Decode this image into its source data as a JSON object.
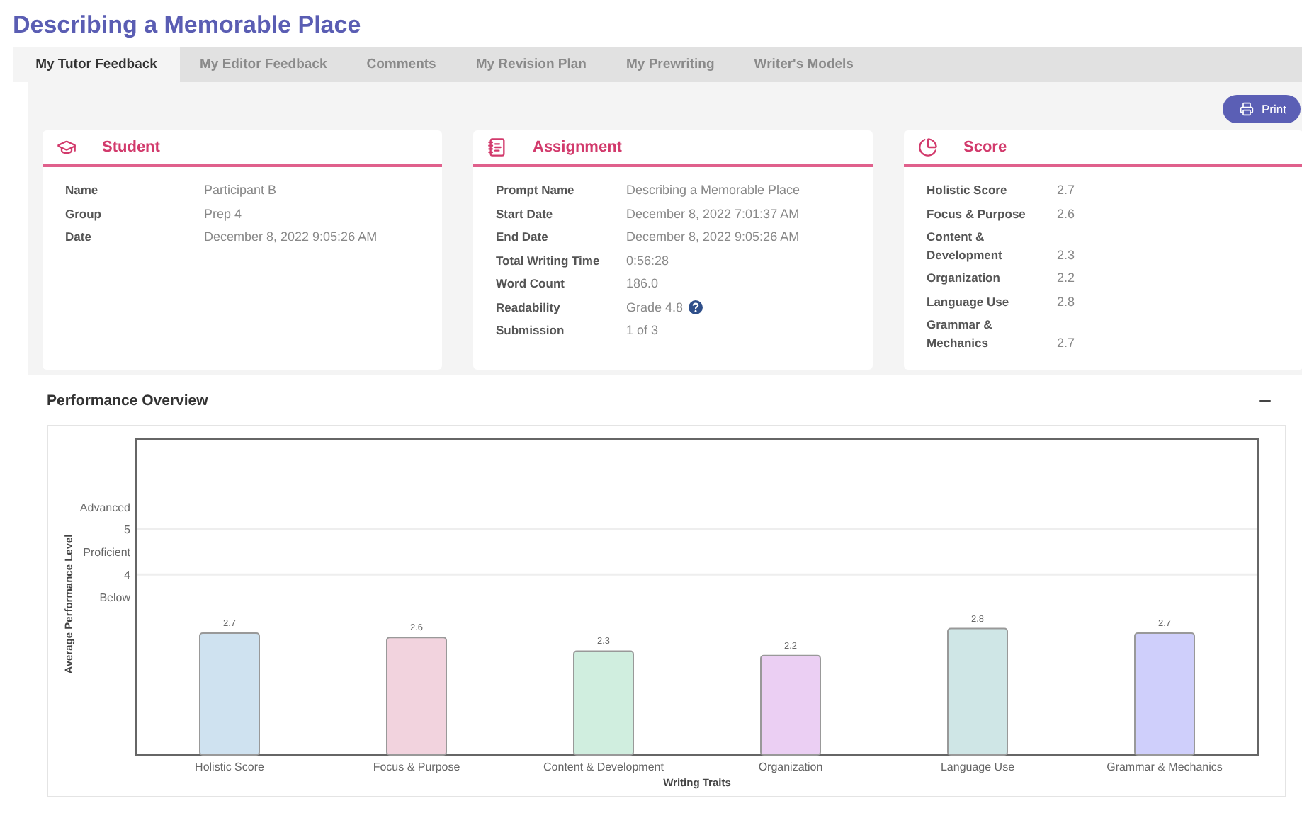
{
  "title": "Describing a Memorable Place",
  "tabs": [
    {
      "label": "My Tutor Feedback",
      "selected": true
    },
    {
      "label": "My Editor Feedback",
      "selected": false
    },
    {
      "label": "Comments",
      "selected": false
    },
    {
      "label": "My Revision Plan",
      "selected": false
    },
    {
      "label": "My Prewriting",
      "selected": false
    },
    {
      "label": "Writer's Models",
      "selected": false
    }
  ],
  "print_button": "Print",
  "cards": [
    {
      "kind": "student",
      "title": "Student",
      "rows": [
        {
          "label": "Name",
          "value": "Participant B",
          "help": false
        },
        {
          "label": "Group",
          "value": "Prep 4",
          "help": false
        },
        {
          "label": "Date",
          "value": "December 8, 2022 9:05:26 AM",
          "help": false
        }
      ]
    },
    {
      "kind": "assignment",
      "title": "Assignment",
      "rows": [
        {
          "label": "Prompt Name",
          "value": "Describing a Memorable Place",
          "help": false
        },
        {
          "label": "Start Date",
          "value": "December 8, 2022 7:01:37 AM",
          "help": false
        },
        {
          "label": "End Date",
          "value": "December 8, 2022 9:05:26 AM",
          "help": false
        },
        {
          "label": "Total Writing Time",
          "value": "0:56:28",
          "help": false
        },
        {
          "label": "Word Count",
          "value": "186.0",
          "help": false
        },
        {
          "label": "Readability",
          "value": "Grade 4.8",
          "help": true
        },
        {
          "label": "Submission",
          "value": "1 of 3",
          "help": false
        }
      ]
    },
    {
      "kind": "score",
      "title": "Score",
      "rows": [
        {
          "label": "Holistic Score",
          "value": "2.7",
          "help": false
        },
        {
          "label": "Focus & Purpose",
          "value": "2.6",
          "help": false
        },
        {
          "label": "Content & Development",
          "value": "2.3",
          "help": false
        },
        {
          "label": "Organization",
          "value": "2.2",
          "help": false
        },
        {
          "label": "Language Use",
          "value": "2.8",
          "help": false
        },
        {
          "label": "Grammar & Mechanics",
          "value": "2.7",
          "help": false
        }
      ]
    }
  ],
  "performance": {
    "title": "Performance Overview",
    "expanded": true,
    "chart_data": {
      "type": "bar",
      "xlabel": "Writing Traits",
      "ylabel": "Average Performance Level",
      "categories": [
        "Holistic Score",
        "Focus & Purpose",
        "Content & Development",
        "Organization",
        "Language Use",
        "Grammar & Mechanics"
      ],
      "values": [
        2.7,
        2.6,
        2.3,
        2.2,
        2.8,
        2.7
      ],
      "colors": [
        "#cfe2f0",
        "#f2d3de",
        "#d0eedf",
        "#ebcff3",
        "#cfe6e6",
        "#cfcffb"
      ],
      "ylim": [
        0,
        7
      ],
      "yticks": [
        {
          "value": 3.5,
          "label": "Below"
        },
        {
          "value": 4,
          "label": "4"
        },
        {
          "value": 4.5,
          "label": "Proficient"
        },
        {
          "value": 5,
          "label": "5"
        },
        {
          "value": 5.5,
          "label": "Advanced"
        }
      ],
      "data_labels": true
    }
  }
}
